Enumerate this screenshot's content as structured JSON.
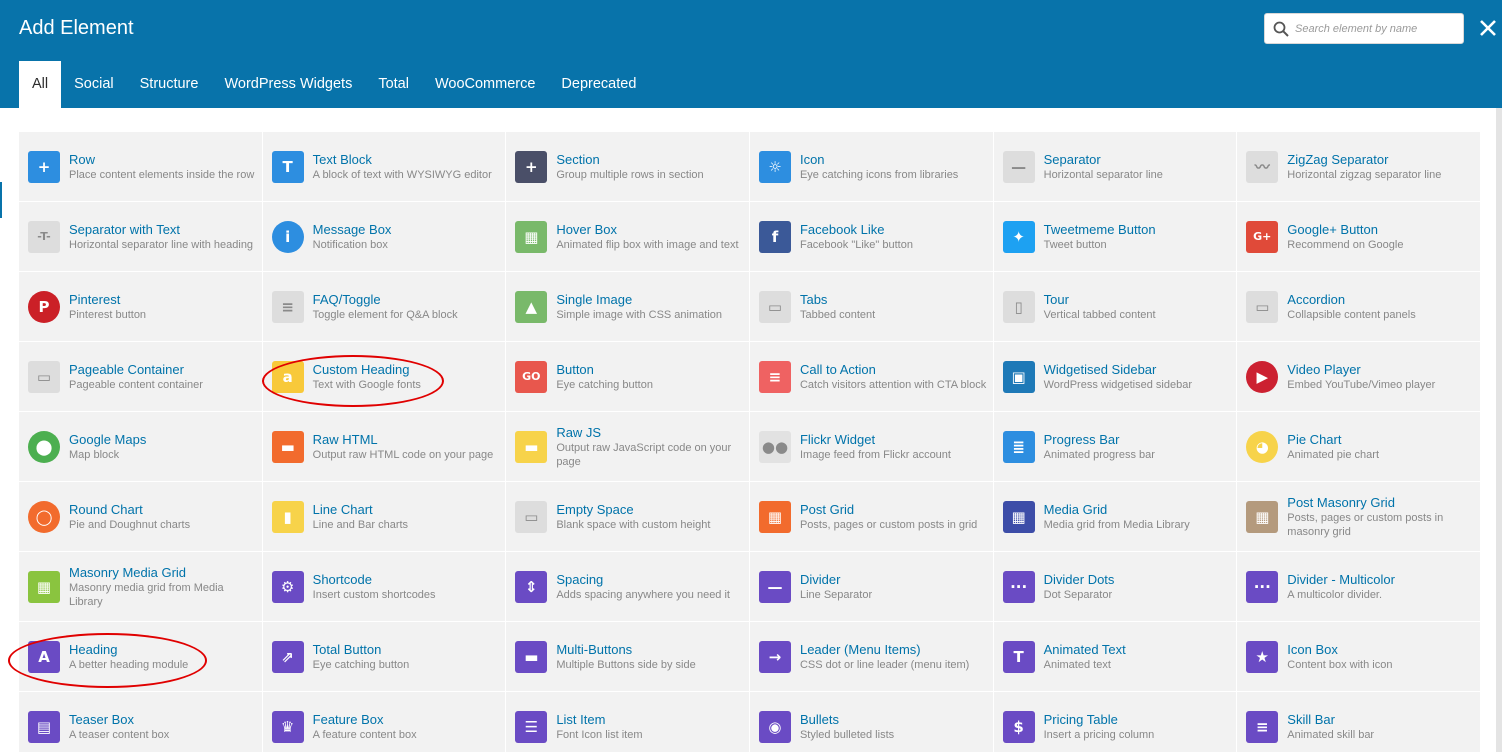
{
  "window": {
    "title": "Add Element"
  },
  "search": {
    "placeholder": "Search element by name"
  },
  "tabs": [
    "All",
    "Social",
    "Structure",
    "WordPress Widgets",
    "Total",
    "WooCommerce",
    "Deprecated"
  ],
  "active_tab": "All",
  "colors": {
    "header": "#0873aa",
    "link": "#0073aa",
    "cell_bg": "#f2f2f2",
    "highlight": "#e00000"
  },
  "elements": [
    {
      "name": "Row",
      "desc": "Place content elements inside the row",
      "icon": "plus-icon",
      "color": "#2d8ee0"
    },
    {
      "name": "Text Block",
      "desc": "A block of text with WYSIWYG editor",
      "icon": "text-t-icon",
      "color": "#2d8ee0"
    },
    {
      "name": "Section",
      "desc": "Group multiple rows in section",
      "icon": "plus-dark-icon",
      "color": "#4a4f68"
    },
    {
      "name": "Icon",
      "desc": "Eye catching icons from libraries",
      "icon": "sun-icon",
      "color": "#2d8ee0"
    },
    {
      "name": "Separator",
      "desc": "Horizontal separator line",
      "icon": "separator-line-icon",
      "color": "#dddddd"
    },
    {
      "name": "ZigZag Separator",
      "desc": "Horizontal zigzag separator line",
      "icon": "zigzag-icon",
      "color": "#dddddd"
    },
    {
      "name": "Separator with Text",
      "desc": "Horizontal separator line with heading",
      "icon": "separator-text-icon",
      "color": "#dddddd"
    },
    {
      "name": "Message Box",
      "desc": "Notification box",
      "icon": "info-icon",
      "color": "#2d8ee0"
    },
    {
      "name": "Hover Box",
      "desc": "Animated flip box with image and text",
      "icon": "hover-box-icon",
      "color": "#79b96a"
    },
    {
      "name": "Facebook Like",
      "desc": "Facebook \"Like\" button",
      "icon": "facebook-icon",
      "color": "#3b5998"
    },
    {
      "name": "Tweetmeme Button",
      "desc": "Tweet button",
      "icon": "twitter-icon",
      "color": "#1da1f2"
    },
    {
      "name": "Google+ Button",
      "desc": "Recommend on Google",
      "icon": "google-plus-icon",
      "color": "#e04a39"
    },
    {
      "name": "Pinterest",
      "desc": "Pinterest button",
      "icon": "pinterest-icon",
      "color": "#cb2027"
    },
    {
      "name": "FAQ/Toggle",
      "desc": "Toggle element for Q&A block",
      "icon": "toggle-icon",
      "color": "#dddddd"
    },
    {
      "name": "Single Image",
      "desc": "Simple image with CSS animation",
      "icon": "image-icon",
      "color": "#79b96a"
    },
    {
      "name": "Tabs",
      "desc": "Tabbed content",
      "icon": "tabs-icon",
      "color": "#dddddd"
    },
    {
      "name": "Tour",
      "desc": "Vertical tabbed content",
      "icon": "tour-icon",
      "color": "#dddddd"
    },
    {
      "name": "Accordion",
      "desc": "Collapsible content panels",
      "icon": "accordion-icon",
      "color": "#dddddd"
    },
    {
      "name": "Pageable Container",
      "desc": "Pageable content container",
      "icon": "pageable-icon",
      "color": "#dddddd"
    },
    {
      "name": "Custom Heading",
      "desc": "Text with Google fonts",
      "icon": "custom-heading-icon",
      "color": "#f8c93a"
    },
    {
      "name": "Button",
      "desc": "Eye catching button",
      "icon": "button-go-icon",
      "color": "#e8574d"
    },
    {
      "name": "Call to Action",
      "desc": "Catch visitors attention with CTA block",
      "icon": "cta-icon",
      "color": "#ef6262"
    },
    {
      "name": "Widgetised Sidebar",
      "desc": "WordPress widgetised sidebar",
      "icon": "sidebar-icon",
      "color": "#1e79b7"
    },
    {
      "name": "Video Player",
      "desc": "Embed YouTube/Vimeo player",
      "icon": "play-icon",
      "color": "#cc2131"
    },
    {
      "name": "Google Maps",
      "desc": "Map block",
      "icon": "map-pin-icon",
      "color": "#4caf50"
    },
    {
      "name": "Raw HTML",
      "desc": "Output raw HTML code on your page",
      "icon": "raw-html-icon",
      "color": "#f26b2d"
    },
    {
      "name": "Raw JS",
      "desc": "Output raw JavaScript code on your page",
      "icon": "raw-js-icon",
      "color": "#f7d34a"
    },
    {
      "name": "Flickr Widget",
      "desc": "Image feed from Flickr account",
      "icon": "flickr-icon",
      "color": "#e2e2e2"
    },
    {
      "name": "Progress Bar",
      "desc": "Animated progress bar",
      "icon": "progress-bar-icon",
      "color": "#2d8ee0"
    },
    {
      "name": "Pie Chart",
      "desc": "Animated pie chart",
      "icon": "pie-chart-icon",
      "color": "#f7d34a"
    },
    {
      "name": "Round Chart",
      "desc": "Pie and Doughnut charts",
      "icon": "round-chart-icon",
      "color": "#f26b2d"
    },
    {
      "name": "Line Chart",
      "desc": "Line and Bar charts",
      "icon": "line-chart-icon",
      "color": "#f7d34a"
    },
    {
      "name": "Empty Space",
      "desc": "Blank space with custom height",
      "icon": "empty-space-icon",
      "color": "#dddddd"
    },
    {
      "name": "Post Grid",
      "desc": "Posts, pages or custom posts in grid",
      "icon": "post-grid-icon",
      "color": "#f26b2d"
    },
    {
      "name": "Media Grid",
      "desc": "Media grid from Media Library",
      "icon": "media-grid-icon",
      "color": "#3d4da8"
    },
    {
      "name": "Post Masonry Grid",
      "desc": "Posts, pages or custom posts in masonry grid",
      "icon": "post-masonry-icon",
      "color": "#b49a7d"
    },
    {
      "name": "Masonry Media Grid",
      "desc": "Masonry media grid from Media Library",
      "icon": "masonry-media-icon",
      "color": "#8ac43f"
    },
    {
      "name": "Shortcode",
      "desc": "Insert custom shortcodes",
      "icon": "gear-icon",
      "color": "#6a4bc4"
    },
    {
      "name": "Spacing",
      "desc": "Adds spacing anywhere you need it",
      "icon": "spacing-icon",
      "color": "#6a4bc4"
    },
    {
      "name": "Divider",
      "desc": "Line Separator",
      "icon": "divider-icon",
      "color": "#6a4bc4"
    },
    {
      "name": "Divider Dots",
      "desc": "Dot Separator",
      "icon": "divider-dots-icon",
      "color": "#6a4bc4"
    },
    {
      "name": "Divider - Multicolor",
      "desc": "A multicolor divider.",
      "icon": "divider-multicolor-icon",
      "color": "#6a4bc4"
    },
    {
      "name": "Heading",
      "desc": "A better heading module",
      "icon": "heading-a-icon",
      "color": "#6a4bc4"
    },
    {
      "name": "Total Button",
      "desc": "Eye catching button",
      "icon": "external-link-icon",
      "color": "#6a4bc4"
    },
    {
      "name": "Multi-Buttons",
      "desc": "Multiple Buttons side by side",
      "icon": "multi-buttons-icon",
      "color": "#6a4bc4"
    },
    {
      "name": "Leader (Menu Items)",
      "desc": "CSS dot or line leader (menu item)",
      "icon": "arrow-right-icon",
      "color": "#6a4bc4"
    },
    {
      "name": "Animated Text",
      "desc": "Animated text",
      "icon": "animated-text-icon",
      "color": "#6a4bc4"
    },
    {
      "name": "Icon Box",
      "desc": "Content box with icon",
      "icon": "star-icon",
      "color": "#6a4bc4"
    },
    {
      "name": "Teaser Box",
      "desc": "A teaser content box",
      "icon": "file-icon",
      "color": "#6a4bc4"
    },
    {
      "name": "Feature Box",
      "desc": "A feature content box",
      "icon": "trophy-icon",
      "color": "#6a4bc4"
    },
    {
      "name": "List Item",
      "desc": "Font Icon list item",
      "icon": "list-icon",
      "color": "#6a4bc4"
    },
    {
      "name": "Bullets",
      "desc": "Styled bulleted lists",
      "icon": "bullseye-icon",
      "color": "#6a4bc4"
    },
    {
      "name": "Pricing Table",
      "desc": "Insert a pricing column",
      "icon": "dollar-icon",
      "color": "#6a4bc4"
    },
    {
      "name": "Skill Bar",
      "desc": "Animated skill bar",
      "icon": "skill-bar-icon",
      "color": "#6a4bc4"
    }
  ]
}
